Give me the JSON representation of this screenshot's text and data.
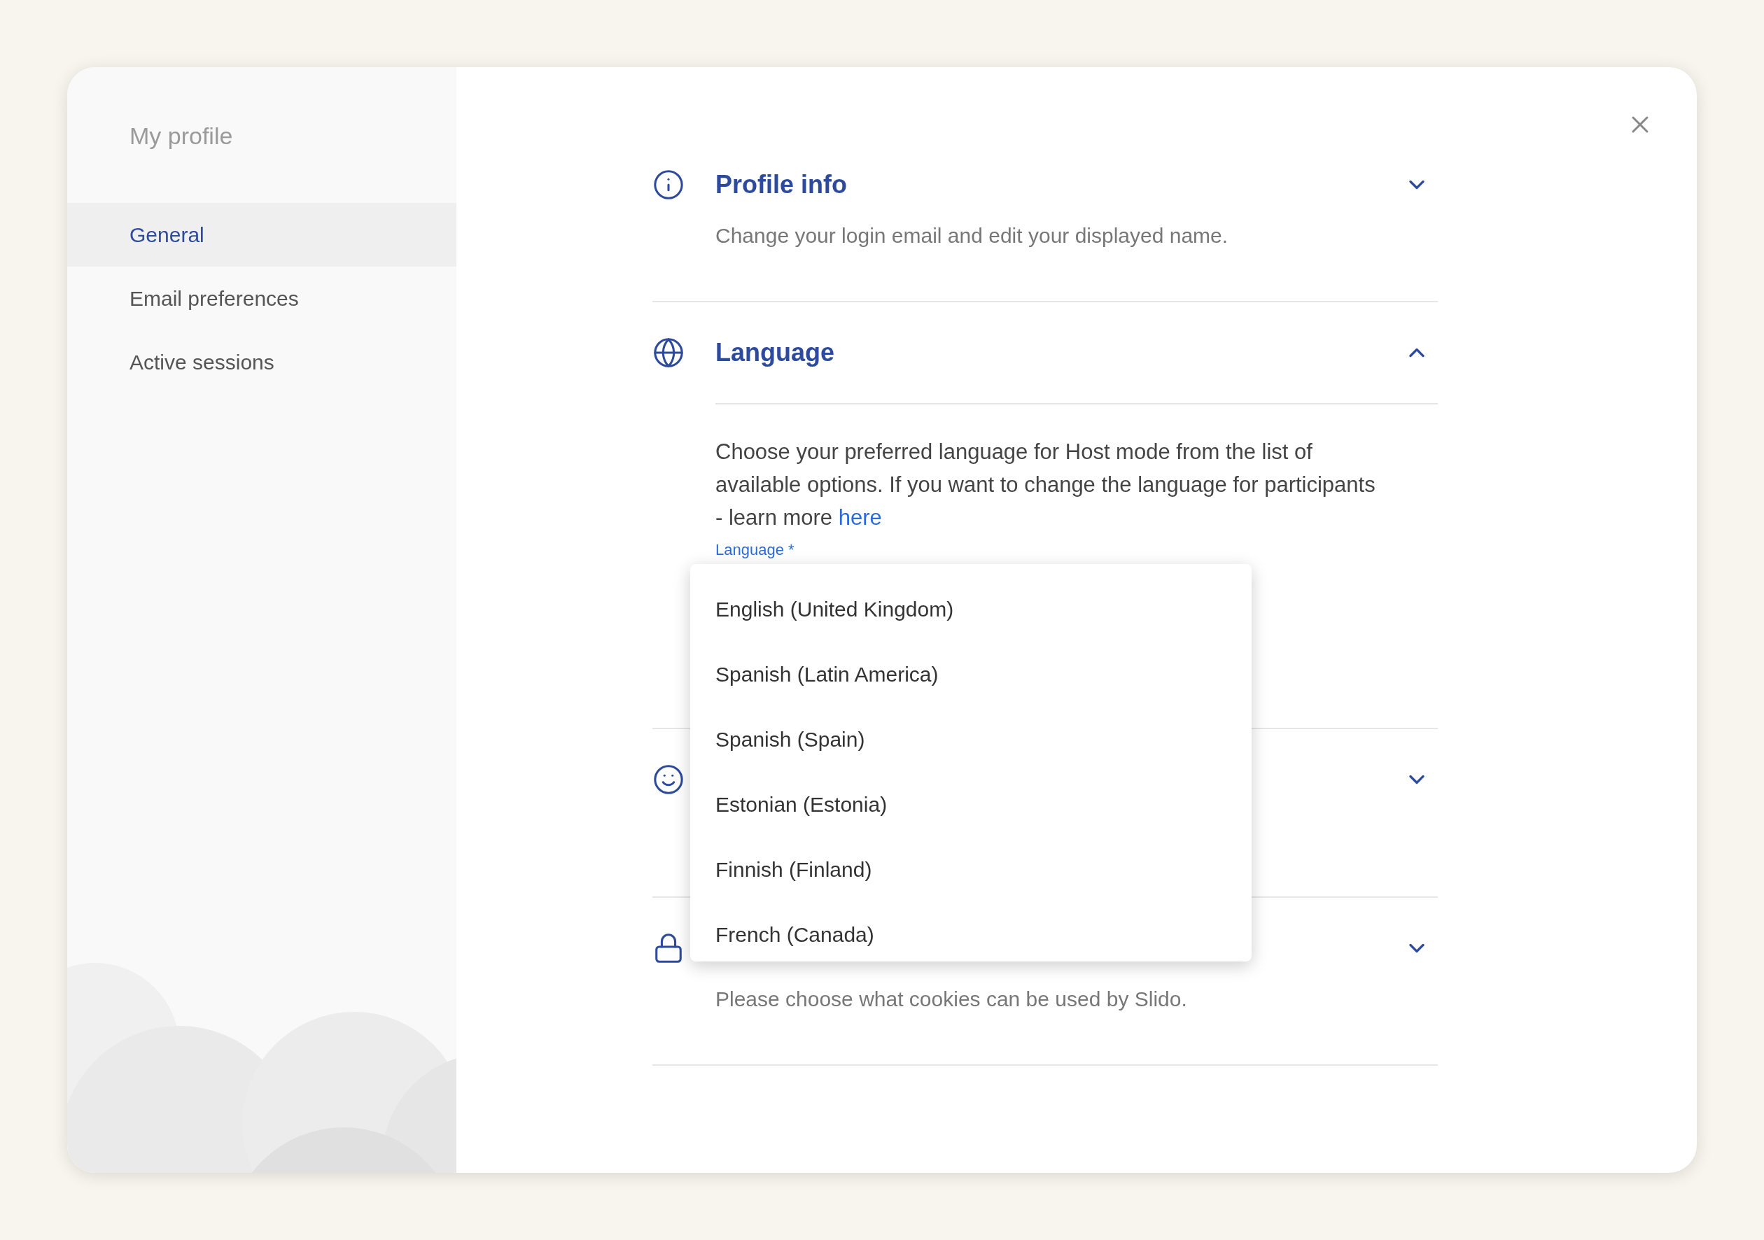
{
  "sidebar": {
    "title": "My profile",
    "items": [
      {
        "label": "General",
        "selected": true
      },
      {
        "label": "Email preferences",
        "selected": false
      },
      {
        "label": "Active sessions",
        "selected": false
      }
    ]
  },
  "sections": [
    {
      "kind": "info",
      "title": "Profile info",
      "expanded": false,
      "description": "Change your login email and edit your displayed name."
    },
    {
      "kind": "globe",
      "title": "Language",
      "expanded": true,
      "body": "Choose your preferred language for Host mode from the list of available options. If you want to change the language for participants - learn more ",
      "link": "here",
      "field_label": "Language *"
    },
    {
      "kind": "smile",
      "expanded": false
    },
    {
      "kind": "lock",
      "expanded": false,
      "description": "Please choose what cookies can be used by Slido."
    }
  ],
  "dropdown": {
    "options": [
      "English (United Kingdom)",
      "Spanish (Latin America)",
      "Spanish (Spain)",
      "Estonian (Estonia)",
      "Finnish (Finland)",
      "French (Canada)"
    ]
  }
}
